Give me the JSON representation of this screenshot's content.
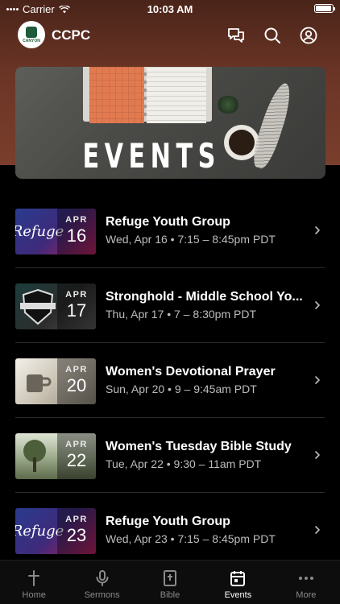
{
  "status_bar": {
    "carrier": "Carrier",
    "time": "10:03 AM",
    "battery_level": 0.95
  },
  "header": {
    "title": "CCPC",
    "logo_text": "CANYON"
  },
  "banner": {
    "title": "EVENTS"
  },
  "events": [
    {
      "title": "Refuge Youth Group",
      "time": "Wed, Apr 16 • 7:15 – 8:45pm PDT",
      "month": "APR",
      "day": "16",
      "art": "Refuge"
    },
    {
      "title": "Stronghold - Middle School Yo...",
      "time": "Thu, Apr 17 • 7 – 8:30pm PDT",
      "month": "APR",
      "day": "17",
      "art": ""
    },
    {
      "title": "Women's Devotional Prayer",
      "time": "Sun, Apr 20 • 9 – 9:45am PDT",
      "month": "APR",
      "day": "20",
      "art": ""
    },
    {
      "title": "Women's Tuesday Bible Study",
      "time": "Tue, Apr 22 • 9:30 – 11am PDT",
      "month": "APR",
      "day": "22",
      "art": ""
    },
    {
      "title": "Refuge Youth Group",
      "time": "Wed, Apr 23 • 7:15 – 8:45pm PDT",
      "month": "APR",
      "day": "23",
      "art": "Refuge"
    }
  ],
  "tabs": [
    {
      "label": "Home",
      "icon": "cross-icon",
      "active": false
    },
    {
      "label": "Sermons",
      "icon": "microphone-icon",
      "active": false
    },
    {
      "label": "Bible",
      "icon": "bible-icon",
      "active": false
    },
    {
      "label": "Events",
      "icon": "calendar-icon",
      "active": true
    },
    {
      "label": "More",
      "icon": "more-icon",
      "active": false
    }
  ]
}
